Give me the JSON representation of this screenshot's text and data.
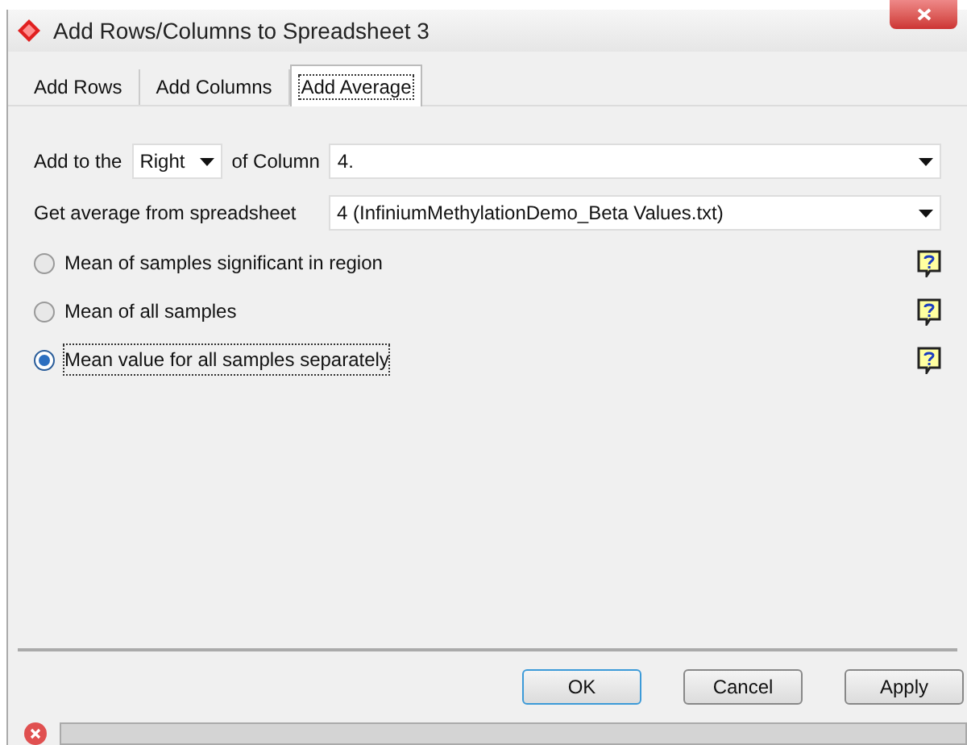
{
  "window": {
    "title": "Add Rows/Columns to Spreadsheet 3"
  },
  "tabs": [
    {
      "label": "Add Rows",
      "selected": false
    },
    {
      "label": "Add Columns",
      "selected": false
    },
    {
      "label": "Add Average",
      "selected": true
    }
  ],
  "position_row": {
    "label_before": "Add to the",
    "side": "Right",
    "label_after": "of Column",
    "column": "4."
  },
  "source_row": {
    "label": "Get average from spreadsheet",
    "spreadsheet": "4 (InfiniumMethylationDemo_Beta Values.txt)"
  },
  "options": [
    {
      "label": "Mean of samples significant in region",
      "selected": false
    },
    {
      "label": "Mean of all samples",
      "selected": false
    },
    {
      "label": "Mean value for all samples separately",
      "selected": true
    }
  ],
  "buttons": [
    "OK",
    "Cancel",
    "Apply"
  ]
}
